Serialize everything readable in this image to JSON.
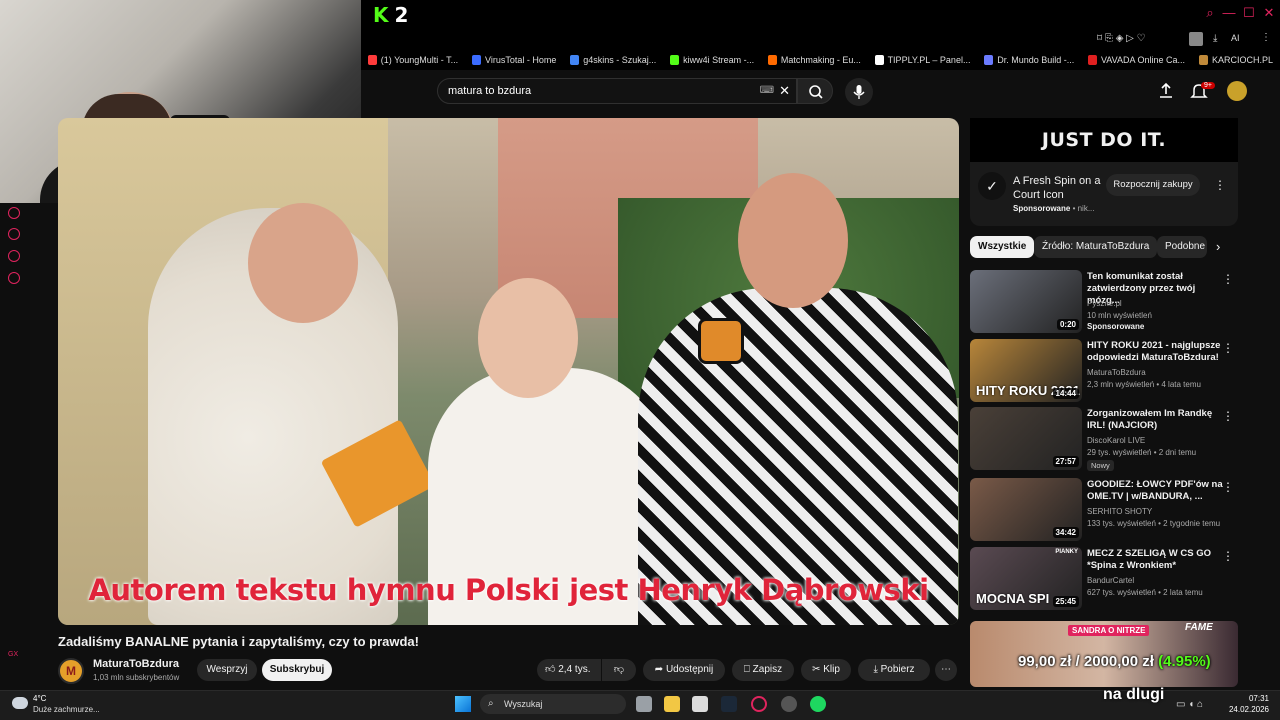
{
  "browser": {
    "kick_number": "2",
    "bookmarks": [
      {
        "label": "(1) YoungMulti - T...",
        "color": "#ff3b3b"
      },
      {
        "label": "VirusTotal - Home",
        "color": "#3b6cff"
      },
      {
        "label": "g4skins - Szukaj...",
        "color": "#4285f4"
      },
      {
        "label": "kiww4i Stream -...",
        "color": "#53fc18"
      },
      {
        "label": "Matchmaking - Eu...",
        "color": "#ff6a00"
      },
      {
        "label": "TIPPLY.PL – Panel...",
        "color": "#ffffff"
      },
      {
        "label": "Dr. Mundo Build -...",
        "color": "#6b7bff"
      },
      {
        "label": "VAVADA Online Ca...",
        "color": "#e02020"
      },
      {
        "label": "KARCIOCH.PL",
        "color": "#c08a3a"
      }
    ],
    "ai_label": "AI"
  },
  "youtube": {
    "search_value": "matura to bzdura",
    "notif_count": "9+",
    "video": {
      "caption": "Autorem tekstu hymnu Polski jest Henryk Dąbrowski",
      "title": "Zadaliśmy BANALNE pytania i zapytaliśmy, czy to prawda!",
      "channel_initial": "M",
      "channel_name": "MaturaToBzdura",
      "subscribers": "1,03 mln subskrybentów",
      "support_label": "Wesprzyj",
      "subscribe_label": "Subskrybuj",
      "likes": "2,4 tys.",
      "share_label": "Udostępnij",
      "save_label": "Zapisz",
      "clip_label": "Klip",
      "download_label": "Pobierz"
    },
    "ad": {
      "banner": "JUST DO IT.",
      "title": "A Fresh Spin on a Court Icon",
      "sponsored": "Sponsorowane",
      "advertiser": "nik...",
      "cta": "Rozpocznij zakupy"
    },
    "chips": [
      "Wszystkie",
      "Źródło: MaturaToBzdura",
      "Podobne"
    ],
    "recommendations": [
      {
        "title": "Ten komunikat został zatwierdzony przez twój mózg...",
        "channel": "Pyszne.pl",
        "meta": "10 mln wyświetleń",
        "badge": "Sponsorowane",
        "duration": "0:20",
        "thumb": "#6b6f7a"
      },
      {
        "title": "HITY ROKU 2021 - najglupsze odpowiedzi MaturaToBzdura!",
        "channel": "MaturaToBzdura",
        "meta": "2,3 mln wyświetleń • 4 lata temu",
        "duration": "14:44",
        "thumb": "#b8863a",
        "thumb_text": "HITY ROKU 2021"
      },
      {
        "title": "Zorganizowałem Im Randkę IRL! (NAJCIOR)",
        "channel": "DiscoKarol LIVE",
        "meta": "29 tys. wyświetleń • 2 dni temu",
        "new": "Nowy",
        "duration": "27:57",
        "thumb": "#4a4038"
      },
      {
        "title": "GOODIEZ: ŁOWCY PDF'ów na OME.TV | w/BANDURA, ...",
        "channel": "SERHITO SHOTY",
        "meta": "133 tys. wyświetleń • 2 tygodnie temu",
        "duration": "34:42",
        "thumb": "#7a5a48"
      },
      {
        "title": "MECZ Z SZELIGĄ W CS GO *Spina z Wronkiem*",
        "channel": "BandurCartel",
        "meta": "627 tys. wyświetleń • 2 lata temu",
        "duration": "25:45",
        "thumb": "#5a4a52",
        "thumb_text": "MOCNA SPI",
        "thumb_tag": "PIANKY"
      }
    ]
  },
  "overlay": {
    "donation_label": "SANDRA O NITRZE",
    "fame_label": "FAME",
    "amount_current": "99,00 zł",
    "amount_goal": "2000,00 zł",
    "percent": "(4.95%)",
    "caption": "na dlugi"
  },
  "taskbar": {
    "temp": "4°C",
    "weather": "Duże zachmurze...",
    "search_placeholder": "Wyszukaj",
    "time": "07:31",
    "date": "24.02.2026"
  }
}
